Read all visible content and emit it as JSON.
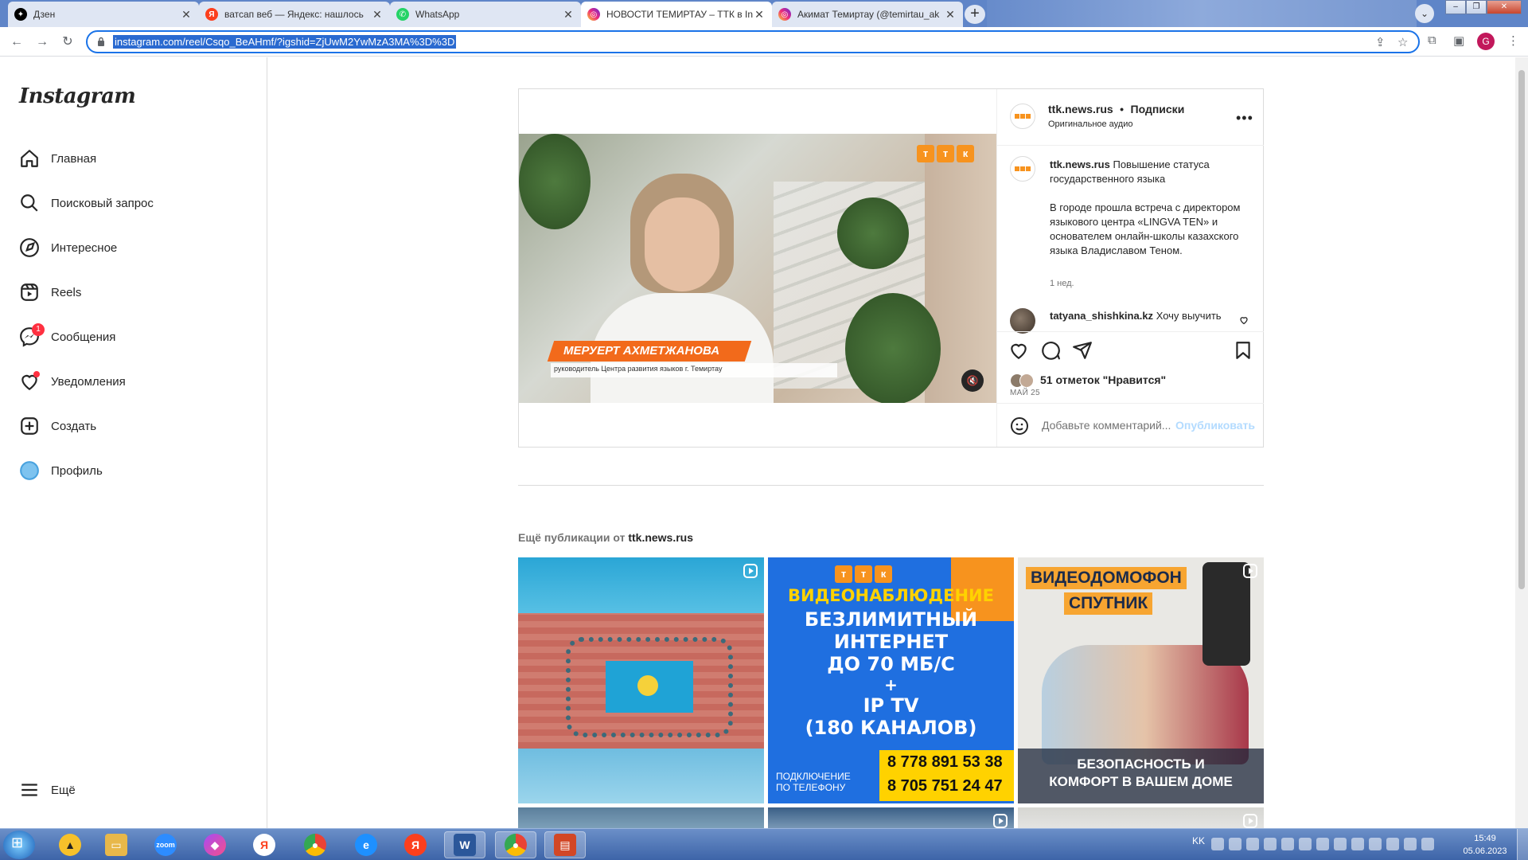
{
  "browser": {
    "tabs": [
      {
        "title": "Дзен",
        "favicon": "dzen-icon",
        "color": "#000000"
      },
      {
        "title": "ватсап веб — Яндекс: нашлось",
        "favicon": "yandex-icon",
        "color": "#fc3f1d"
      },
      {
        "title": "WhatsApp",
        "favicon": "whatsapp-icon",
        "color": "#25d366"
      },
      {
        "title": "НОВОСТИ ТЕМИРТАУ – ТТК в In",
        "favicon": "instagram-icon",
        "color": "#d6249f"
      },
      {
        "title": "Акимат Темиртау (@temirtau_ak",
        "favicon": "instagram-icon",
        "color": "#d6249f"
      }
    ],
    "url": "instagram.com/reel/Csqo_BeAHmf/?igshid=ZjUwM2YwMzA3MA%3D%3D",
    "profile_initial": "G"
  },
  "instagram": {
    "logo": "Instagram",
    "nav": [
      {
        "label": "Главная",
        "icon": "home-icon"
      },
      {
        "label": "Поисковый запрос",
        "icon": "search-icon"
      },
      {
        "label": "Интересное",
        "icon": "compass-icon"
      },
      {
        "label": "Reels",
        "icon": "reels-icon"
      },
      {
        "label": "Сообщения",
        "icon": "messenger-icon",
        "badge": "1"
      },
      {
        "label": "Уведомления",
        "icon": "heart-icon"
      },
      {
        "label": "Создать",
        "icon": "create-icon"
      },
      {
        "label": "Профиль",
        "icon": "profile-avatar"
      }
    ],
    "more_label": "Ещё"
  },
  "post": {
    "video": {
      "name_overlay": "МЕРУЕРТ АХМЕТЖАНОВА",
      "subtitle_overlay": "руководитель Центра развития языков г. Темиртау",
      "logo_letters": [
        "т",
        "т",
        "к"
      ]
    },
    "account": "ttk.news.rus",
    "separator": "•",
    "follow": "Подписки",
    "audio": "Оригинальное аудио",
    "caption_title": "Повышение статуса государственного языка",
    "caption_body": "В городе прошла встреча с директором языкового центра «LINGVA TEN» и основателем онлайн-школы казахского языка Владиславом Теном.",
    "caption_time": "1 нед.",
    "comment_user": "tatyana_shishkina.kz",
    "comment_text": "Хочу выучить",
    "likes": "51 отметок \"Нравится\"",
    "date": "МАЙ 25",
    "comment_placeholder": "Добавьте комментарий...",
    "publish": "Опубликовать"
  },
  "more_posts": {
    "title_prefix": "Ещё публикации от",
    "account": "ttk.news.rus",
    "tile2": {
      "logo_letters": [
        "т",
        "т",
        "к"
      ],
      "line1": "ВИДЕОНАБЛЮДЕНИЕ",
      "line2": "БЕЗЛИМИТНЫЙ",
      "line3": "ИНТЕРНЕТ",
      "line4": "ДО 70 МБ/С",
      "line5": "+",
      "line6": "IP TV",
      "line7": "(180 КАНАЛОВ)",
      "connect1": "ПОДКЛЮЧЕНИЕ",
      "connect2": "ПО ТЕЛЕФОНУ",
      "phone1": "8 778 891 53 38",
      "phone2": "8 705 751 24 47"
    },
    "tile3": {
      "title1": "ВИДЕОДОМОФОН",
      "title2": "СПУТНИК",
      "banner1": "БЕЗОПАСНОСТЬ И",
      "banner2": "КОМФОРТ В ВАШЕМ ДОМЕ"
    }
  },
  "taskbar": {
    "apps": [
      "arrow-app-icon",
      "explorer-icon",
      "zoom-icon",
      "gem-icon",
      "yandex-browser-icon",
      "chrome-icon",
      "ie-icon",
      "yandex-icon",
      "word-icon",
      "chrome-active-icon",
      "presentation-icon"
    ],
    "lang": "KK",
    "time": "15:49",
    "date": "05.06.2023"
  }
}
